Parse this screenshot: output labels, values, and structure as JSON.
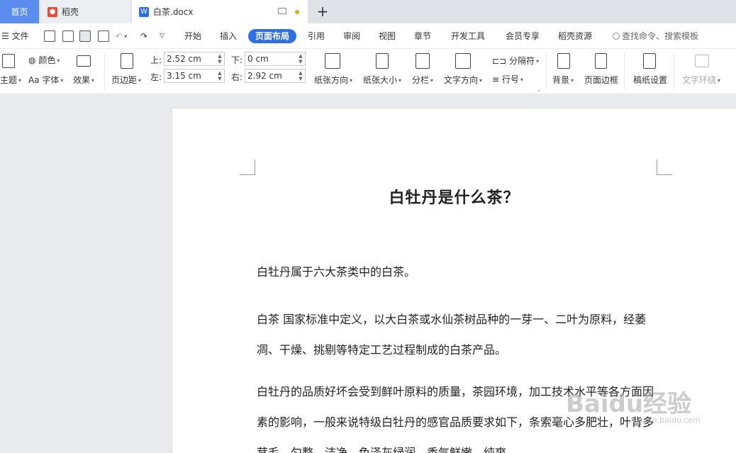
{
  "tabs": {
    "home": "首页",
    "daoke": "稻壳",
    "active": "白茶.docx"
  },
  "menubar": {
    "file": "文件",
    "items": [
      "开始",
      "插入",
      "页面布局",
      "引用",
      "审阅",
      "视图",
      "章节",
      "开发工具",
      "会员专享",
      "稻壳资源"
    ],
    "active_index": 2,
    "search": "查找命令、搜索模板"
  },
  "ribbon": {
    "theme": "主题",
    "color": "颜色",
    "font": "Aa 字体",
    "effect": "效果",
    "margins": "页边距",
    "top_label": "上:",
    "top_value": "2.52 cm",
    "left_label": "左:",
    "left_value": "3.15 cm",
    "bottom_label": "下:",
    "bottom_value": "0 cm",
    "right_label": "右:",
    "right_value": "2.92 cm",
    "orientation": "纸张方向",
    "size": "纸张大小",
    "columns": "分栏",
    "text_direction": "文字方向",
    "separator": "分隔符",
    "line_number": "行号",
    "background": "背景",
    "page_border": "页面边框",
    "manuscript": "稿纸设置",
    "text_wrap": "文字环绕"
  },
  "document": {
    "title": "白牡丹是什么茶？",
    "paragraphs": [
      "白牡丹属于六大茶类中的白茶。",
      "  白茶  国家标准中定义，以大白茶或水仙茶树品种的一芽一、二叶为原料，经萎凋、干燥、挑剔等特定工艺过程制成的白茶产品。",
      "白牡丹的品质好坏会受到鲜叶原料的质量，茶园环境，加工技术水平等各方面因素的影响，一般来说特级白牡丹的感官品质要求如下，条索毫心多肥壮，叶背多茸毛，匀整，洁净，色泽灰绿润，香气鲜嫩，纯爽"
    ]
  },
  "watermark": {
    "brand": "Baidu经验",
    "url": "jingyan.baidu.com"
  },
  "colors": {
    "accent": "#2f6fe4",
    "home_tab": "#5b8def"
  }
}
